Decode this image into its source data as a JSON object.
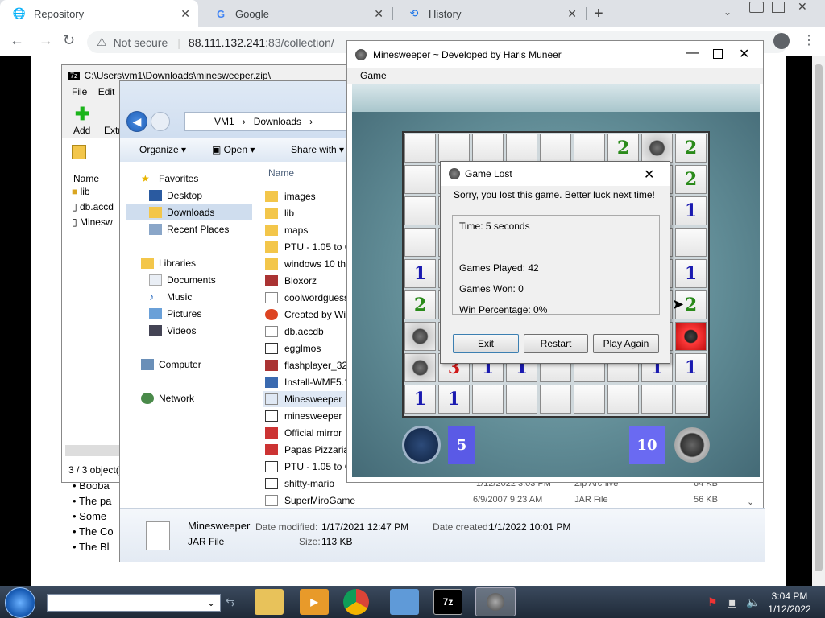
{
  "chrome": {
    "tabs": [
      {
        "label": "Repository",
        "icon": "globe-icon"
      },
      {
        "label": "Google",
        "icon": "google-icon"
      },
      {
        "label": "History",
        "icon": "history-icon"
      }
    ],
    "security": "Not secure",
    "url_host": "88.111.132.241",
    "url_rest": ":83/collection/"
  },
  "page": {
    "list_items": [
      "Booba",
      "The pa",
      "Some",
      "The Co",
      "The Bl"
    ]
  },
  "zip": {
    "title": "C:\\Users\\vm1\\Downloads\\minesweeper.zip\\",
    "menu": [
      "File",
      "Edit"
    ],
    "toolbar": [
      "Add",
      "Extr"
    ],
    "col_name": "Name",
    "items": [
      "lib",
      "db.accd",
      "Minesw"
    ],
    "status": "3 / 3 object("
  },
  "explorer": {
    "path": [
      "VM1",
      "Downloads"
    ],
    "commands": [
      "Organize",
      "Open",
      "Share with"
    ],
    "nav": {
      "favorites": "Favorites",
      "fav_items": [
        "Desktop",
        "Downloads",
        "Recent Places"
      ],
      "libraries": "Libraries",
      "lib_items": [
        "Documents",
        "Music",
        "Pictures",
        "Videos"
      ],
      "computer": "Computer",
      "network": "Network"
    },
    "col_name": "Name",
    "files": [
      "images",
      "lib",
      "maps",
      "PTU - 1.05 to G",
      "windows 10 th",
      "Bloxorz",
      "coolwordguess",
      "Created by Wi",
      "db.accdb",
      "egglmos",
      "flashplayer_32_",
      "Install-WMF5.1",
      "Minesweeper",
      "minesweeper",
      "Official mirror",
      "Papas Pizzaria",
      "PTU - 1.05 to G",
      "shitty-mario",
      "SuperMiroGame"
    ],
    "lower_rows": [
      {
        "date": "1/12/2022 3:03 PM",
        "type": "Zip Archive",
        "size": "64 KB"
      },
      {
        "date": "6/9/2007 9:23 AM",
        "type": "JAR File",
        "size": "56 KB"
      }
    ],
    "details": {
      "name": "Minesweeper",
      "type": "JAR File",
      "modified_label": "Date modified:",
      "modified": "1/17/2021 12:47 PM",
      "created_label": "Date created:",
      "created": "1/1/2022 10:01 PM",
      "size_label": "Size:",
      "size": "113 KB"
    }
  },
  "minesweeper": {
    "title": "Minesweeper ~ Developed by Haris Muneer",
    "menu": "Game",
    "time_value": "5",
    "mines_value": "10",
    "board": [
      [
        "",
        "",
        "",
        "",
        "",
        "",
        "2",
        "M",
        "2"
      ],
      [
        "",
        "",
        "",
        "",
        "",
        "",
        "",
        "",
        "2"
      ],
      [
        "",
        "",
        "",
        "",
        "",
        "",
        "",
        "",
        "1"
      ],
      [
        "",
        "",
        "",
        "",
        "",
        "",
        "",
        "",
        ""
      ],
      [
        "1",
        "",
        "",
        "",
        "",
        "",
        "",
        "",
        "1"
      ],
      [
        "2",
        "",
        "",
        "",
        "",
        "",
        "",
        "",
        "2"
      ],
      [
        "M",
        "",
        "",
        "",
        "",
        "",
        "",
        "",
        "X"
      ],
      [
        "M",
        "3",
        "1",
        "1",
        "",
        "",
        "",
        "1",
        "1"
      ],
      [
        "1",
        "1",
        "",
        "",
        "",
        "",
        "",
        "",
        ""
      ]
    ]
  },
  "dialog": {
    "title": "Game Lost",
    "message": "Sorry, you lost this game. Better luck next time!",
    "time": "Time:  5 seconds",
    "played": "Games Played:  42",
    "won": "Games Won:  0",
    "pct": "Win Percentage:  0%",
    "buttons": [
      "Exit",
      "Restart",
      "Play Again"
    ]
  },
  "taskbar": {
    "apps": [
      "explorer-icon",
      "media-player-icon",
      "chrome-icon",
      "control-panel-icon",
      "7zip-icon",
      "minesweeper-icon"
    ],
    "zip_label": "7z",
    "time": "3:04 PM",
    "date": "1/12/2022"
  }
}
